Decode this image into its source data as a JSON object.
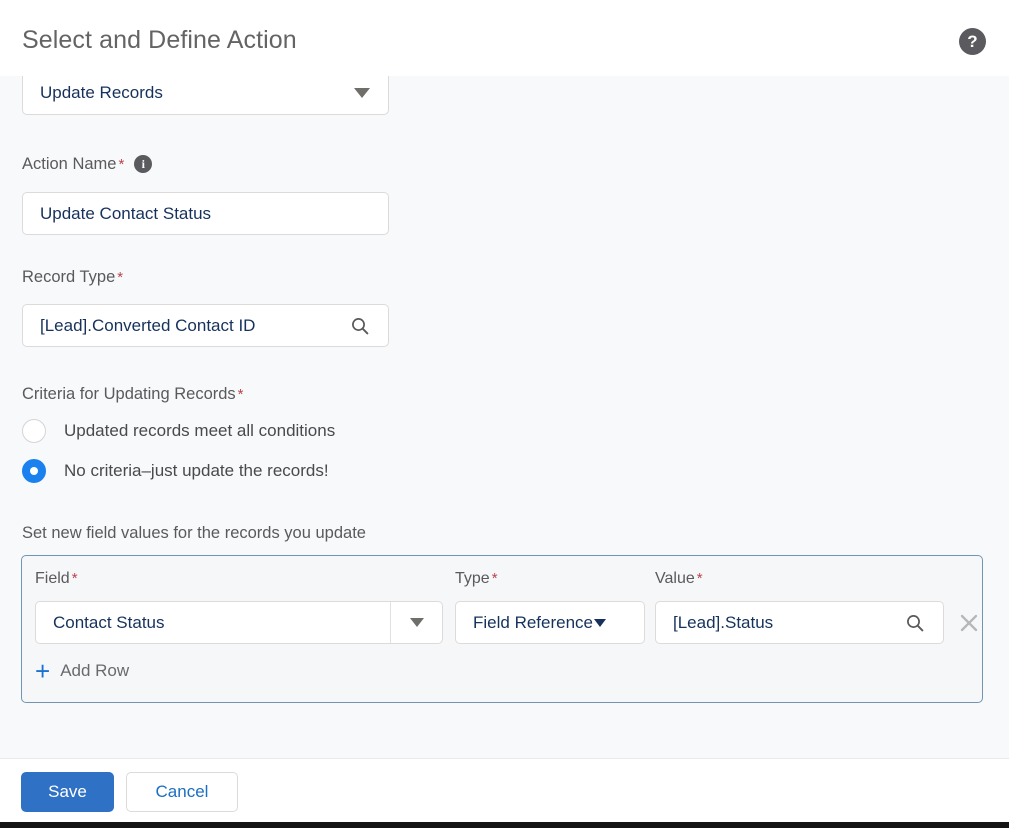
{
  "header": {
    "title": "Select and Define Action",
    "help_icon": "help-question-circle-icon",
    "help_glyph": "?"
  },
  "action_type": {
    "value": "Update Records",
    "caret_icon": "chevron-down-icon"
  },
  "action_name": {
    "label": "Action Name",
    "required_marker": "*",
    "info_icon": "info-circle-icon",
    "info_glyph": "i",
    "value": "Update Contact Status",
    "placeholder": ""
  },
  "record_type": {
    "label": "Record Type",
    "required_marker": "*",
    "value": "[Lead].Converted Contact ID",
    "placeholder": "",
    "search_icon": "search-icon"
  },
  "criteria": {
    "label": "Criteria for Updating Records",
    "required_marker": "*",
    "options": [
      {
        "label": "Updated records meet all conditions",
        "selected": false
      },
      {
        "label": "No criteria–just update the records!",
        "selected": true
      }
    ]
  },
  "field_values": {
    "caption": "Set new field values for the records you update",
    "columns": {
      "field": "Field",
      "type": "Type",
      "value": "Value"
    },
    "required_marker": "*",
    "rows": [
      {
        "field": "Contact Status",
        "type": "Field Reference",
        "value": "[Lead].Status",
        "field_caret_icon": "chevron-down-icon",
        "type_caret_icon": "chevron-down-icon",
        "value_search_icon": "search-icon",
        "delete_icon": "close-x-icon"
      }
    ],
    "add_row": {
      "label": "Add Row",
      "plus_icon": "plus-icon",
      "plus_glyph": "+"
    }
  },
  "footer": {
    "save_label": "Save",
    "cancel_label": "Cancel"
  },
  "colors": {
    "accent_blue": "#1b81ef",
    "save_blue": "#2f71c4",
    "link_blue": "#1b6fc4",
    "panel_border": "#7295b4",
    "required_red": "#b9444c",
    "page_bg": "#f8f9fb",
    "text_dark": "#16325c",
    "label_gray": "#5a5a5d"
  }
}
